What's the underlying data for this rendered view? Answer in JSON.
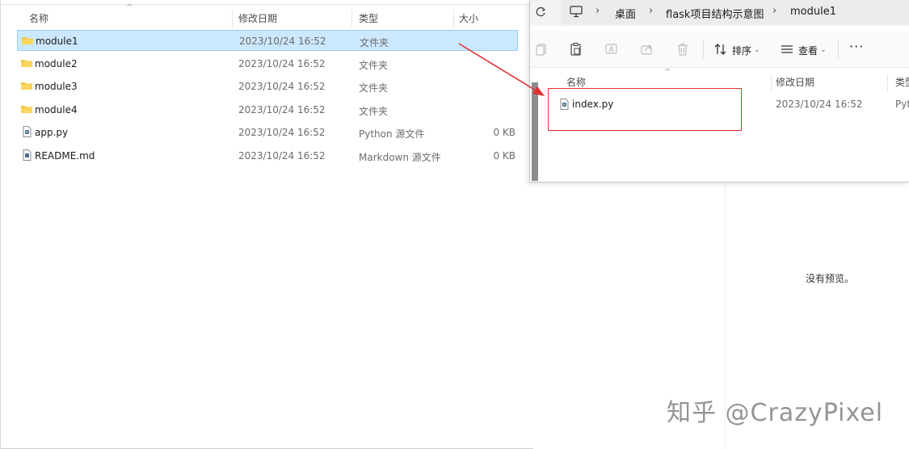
{
  "left_explorer": {
    "columns": {
      "name": "名称",
      "modified": "修改日期",
      "type": "类型",
      "size": "大小"
    },
    "rows": [
      {
        "name": "module1",
        "modified": "2023/10/24 16:52",
        "type": "文件夹",
        "size": "",
        "icon": "folder-icon",
        "selected": true
      },
      {
        "name": "module2",
        "modified": "2023/10/24 16:52",
        "type": "文件夹",
        "size": "",
        "icon": "folder-icon",
        "selected": false
      },
      {
        "name": "module3",
        "modified": "2023/10/24 16:52",
        "type": "文件夹",
        "size": "",
        "icon": "folder-icon",
        "selected": false
      },
      {
        "name": "module4",
        "modified": "2023/10/24 16:52",
        "type": "文件夹",
        "size": "",
        "icon": "folder-icon",
        "selected": false
      },
      {
        "name": "app.py",
        "modified": "2023/10/24 16:52",
        "type": "Python 源文件",
        "size": "0 KB",
        "icon": "python-file-icon",
        "selected": false
      },
      {
        "name": "README.md",
        "modified": "2023/10/24 16:52",
        "type": "Markdown 源文件",
        "size": "0 KB",
        "icon": "markdown-file-icon",
        "selected": false
      }
    ]
  },
  "right_explorer": {
    "breadcrumb": [
      "桌面",
      "flask项目结构示意图",
      "module1"
    ],
    "toolbar": {
      "sort_label": "排序",
      "view_label": "查看"
    },
    "columns": {
      "name": "名称",
      "modified": "修改日期",
      "type": "类型"
    },
    "file": {
      "name": "index.py",
      "modified": "2023/10/24 16:52",
      "type": "Pyt"
    }
  },
  "preview_text": "没有预览。",
  "watermark": "知乎 @CrazyPixel",
  "colors": {
    "selection": "#cce8ff",
    "selection_border": "#99d1ff",
    "annotation": "#e03030",
    "folder": "#f4c542"
  }
}
